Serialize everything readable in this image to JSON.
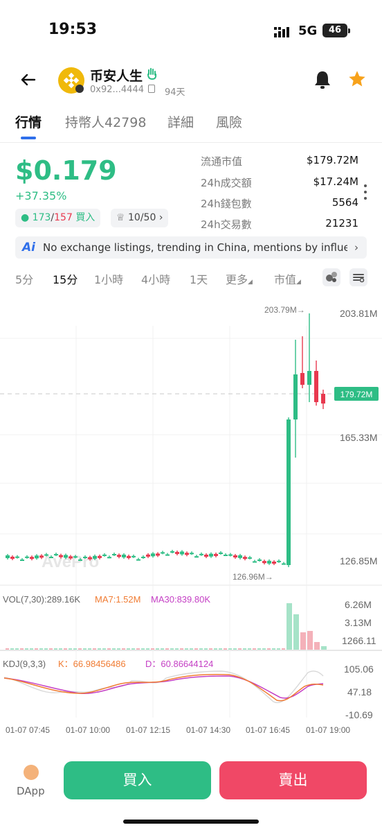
{
  "status_bar": {
    "time": "19:53",
    "network": "5G",
    "battery": "46"
  },
  "token": {
    "name": "币安人生",
    "address": "0x92...4444",
    "age": "94天"
  },
  "tabs": [
    "行情",
    "持幣人42798",
    "詳細",
    "風險"
  ],
  "price": {
    "value": "$0.179",
    "change": "+37.35%"
  },
  "chips": {
    "buys": "173",
    "sep": "/",
    "sells": "157",
    "buy_label": "買入",
    "top": "10/50"
  },
  "stats": [
    {
      "label": "流通市值",
      "value": "$179.72M"
    },
    {
      "label": "24h成交額",
      "value": "$17.24M"
    },
    {
      "label": "24h錢包數",
      "value": "5564"
    },
    {
      "label": "24h交易數",
      "value": "21231"
    }
  ],
  "ai_banner": {
    "icon": "Ai",
    "text": "No exchange listings, trending in China, mentions by influen..."
  },
  "intervals": [
    "5分",
    "15分",
    "1小時",
    "4小時",
    "1天",
    "更多",
    "市值"
  ],
  "colors": {
    "up": "#2ebd85",
    "down": "#e8394f",
    "accent": "#2f6fea"
  },
  "chart_data": {
    "type": "candlestick",
    "y_ticks": [
      "203.81M",
      "165.33M",
      "126.85M"
    ],
    "current_label": "179.72M",
    "high_marker": "203.79M→",
    "low_marker": "126.96M→",
    "x_labels": [
      "01-07 07:45",
      "01-07 10:00",
      "01-07 12:15",
      "01-07 14:30",
      "01-07 16:45",
      "01-07 19:00"
    ],
    "watermark": "AvePro",
    "vol_header": {
      "vol": "VOL(7,30):289.16K",
      "ma7": "MA7:1.52M",
      "ma30": "MA30:839.80K"
    },
    "vol_ticks": [
      "6.26M",
      "3.13M",
      "1266.11"
    ],
    "kdj_header": {
      "kdj": "KDJ(9,3,3)",
      "k": "K：66.98456486",
      "d": "D：60.86644124"
    },
    "kdj_ticks": [
      "105.06",
      "47.18",
      "-10.69"
    ]
  },
  "bottom": {
    "dapp": "DApp",
    "buy": "買入",
    "sell": "賣出"
  }
}
